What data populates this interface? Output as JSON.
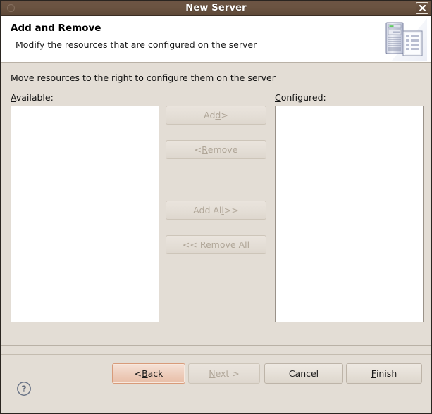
{
  "window": {
    "title": "New Server",
    "close_label": "×",
    "menu_icon": "window-menu-icon"
  },
  "header": {
    "title": "Add and Remove",
    "subtitle": "Modify the resources that are configured on the server",
    "icon": "server-and-document-icon"
  },
  "body": {
    "instruction": "Move resources to the right to configure them on the server",
    "available": {
      "label_pre": "",
      "label_mnemonic": "A",
      "label_post": "vailable:",
      "items": []
    },
    "configured": {
      "label_pre": "",
      "label_mnemonic": "C",
      "label_post": "onfigured:",
      "items": []
    },
    "transfer_buttons": [
      {
        "id": "add",
        "pre": "Ad",
        "mnemonic": "d",
        "post": " >",
        "enabled": false
      },
      {
        "id": "remove",
        "pre": "< ",
        "mnemonic": "R",
        "post": "emove",
        "enabled": false
      },
      {
        "id": "add-all",
        "pre": "Add Al",
        "mnemonic": "l",
        "post": " >>",
        "enabled": false
      },
      {
        "id": "remove-all",
        "pre": "<< Re",
        "mnemonic": "m",
        "post": "ove All",
        "enabled": false
      }
    ]
  },
  "footer": {
    "help_icon": "help-question-icon",
    "buttons": [
      {
        "id": "back",
        "pre": "< ",
        "mnemonic": "B",
        "post": "ack",
        "enabled": true,
        "focused": true
      },
      {
        "id": "next",
        "pre": "",
        "mnemonic": "N",
        "post": "ext >",
        "enabled": false,
        "focused": false
      },
      {
        "id": "cancel",
        "pre": "Cancel",
        "mnemonic": "",
        "post": "",
        "enabled": true,
        "focused": false
      },
      {
        "id": "finish",
        "pre": "",
        "mnemonic": "F",
        "post": "inish",
        "enabled": true,
        "focused": false
      }
    ]
  },
  "colors": {
    "titlebar": "#6a5341",
    "body_bg": "#e3ddd5",
    "header_bg": "#ffffff",
    "list_bg": "#ffffff",
    "focus_accent": "#d89b7a",
    "disabled_text": "#b0a698"
  }
}
